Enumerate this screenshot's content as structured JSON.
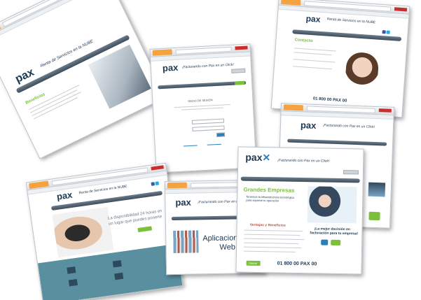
{
  "colors": {
    "brand_navy": "#1c3752",
    "brand_blue": "#2a7fb8",
    "accent_green": "#7bbf3a",
    "browser_tab_orange": "#f4a340",
    "section_teal": "#5a8fa0"
  },
  "brand": {
    "logo_text": "pax",
    "tagline_services": "Renta de Servicios en la NUBE",
    "tagline_click": "¡Facturando con Pax en un Click!"
  },
  "login": {
    "heading": "INICIO DE SESIÓN"
  },
  "contact": {
    "heading": "Contacto",
    "phone": "01 800 00 PAX 00"
  },
  "benefits": {
    "heading": "Beneficios"
  },
  "availability": {
    "text_line1": "La disponibilidad 24 horas en",
    "text_line2": "un lugar que puedes ponerte"
  },
  "apps": {
    "title_line1": "Aplicaciones",
    "title_line2": "Web"
  },
  "companies": {
    "heading": "Grandes Empresas",
    "intro_line1": "Tenemos la infraestructura tecnológica",
    "intro_line2": "para soportar tu operación",
    "advantages_heading": "Ventajas y Beneficios",
    "promo_line1": "¡La mejor decisión en",
    "promo_line2": "facturación para tu empresa!",
    "phone": "01 800 00 PAX 00",
    "phone_button": "Llamar"
  },
  "icons": [
    "browser-tab-icon",
    "window-controls-icon",
    "facebook-icon",
    "twitter-icon",
    "social-icon",
    "laptop-image",
    "woman-headset-image",
    "hand-device-image",
    "businessman-image",
    "books-image"
  ]
}
